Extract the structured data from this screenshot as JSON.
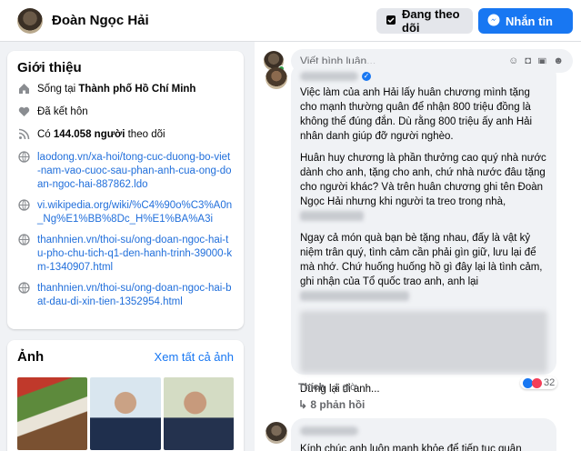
{
  "header": {
    "profile_name": "Đoàn Ngọc Hải",
    "following_label": "Đang theo dõi",
    "message_label": "Nhắn tin"
  },
  "intro": {
    "title": "Giới thiệu",
    "lives_prefix": "Sống tại ",
    "lives_place": "Thành phố Hồ Chí Minh",
    "marital": "Đã kết hôn",
    "followers_prefix": "Có ",
    "followers_count": "144.058 người",
    "followers_suffix": " theo dõi",
    "links": [
      "laodong.vn/xa-hoi/tong-cuc-duong-bo-viet-nam-vao-cuoc-sau-phan-anh-cua-ong-doan-ngoc-hai-887862.ldo",
      "vi.wikipedia.org/wiki/%C4%90o%C3%A0n_Ng%E1%BB%8Dc_H%E1%BA%A3i",
      "thanhnien.vn/thoi-su/ong-doan-ngoc-hai-tu-pho-chu-tich-q1-den-hanh-trinh-39000-km-1340907.html",
      "thanhnien.vn/thoi-su/ong-doan-ngoc-hai-bat-dau-di-xin-tien-1352954.html"
    ]
  },
  "photos": {
    "title": "Ảnh",
    "see_all": "Xem tất cả ảnh"
  },
  "comments": {
    "input_placeholder": "Viết bình luận...",
    "comment1": {
      "para1": "Việc làm của anh Hải lấy huân chương mình tặng cho mạnh thường quân để nhận 800 triệu đồng là không thể đúng đắn. Dù rằng 800 triệu ấy anh Hải nhân danh giúp đỡ người nghèo.",
      "para2": "Huân huy chương là phần thưởng cao quý nhà nước dành cho anh, tặng cho anh, chứ nhà nước đâu tặng cho người khác? Và trên huân chương ghi tên Đoàn Ngọc Hải nhưng khi người ta treo trong nhà,",
      "para3": "Ngay cả món quà bạn bè tặng nhau, đấy là vật kỷ niệm trân quý, tình cảm cần phải gìn giữ, lưu lại để mà nhớ. Chứ huống huống hồ gì đây lại là tình cảm, ghi nhận của Tổ quốc trao anh, anh lại",
      "stop": "Dừng lại đi anh...",
      "like_label": "Thích",
      "time": "1 giờ",
      "reaction_count": "32",
      "replies_label": "8 phản hồi"
    },
    "comment2": {
      "text": "Kính chúc anh luôn mạnh khỏe để tiếp tục quân hành mãi"
    }
  }
}
